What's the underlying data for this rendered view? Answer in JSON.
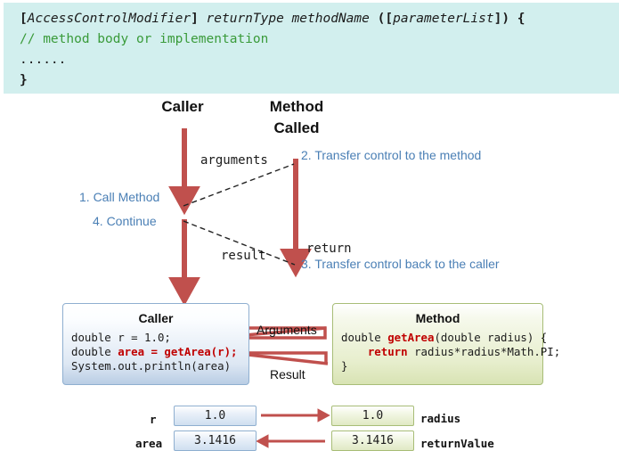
{
  "syntax_block": {
    "bg_color": "#d2efee",
    "line1": {
      "open_bracket": "[",
      "modifier": "AccessControlModifier",
      "close_bracket": "]",
      "return_type": "returnType",
      "method_name": "methodName",
      "open_paren": "(",
      "open_bracket2": "[",
      "parameter_list": "parameterList",
      "close_bracket2": "]",
      "close_paren": ")",
      "open_brace": "{",
      "full": "[AccessControlModifier] returnType methodName ([parameterList]) {"
    },
    "line2": "// method body or implementation",
    "line2_color": "#3a9b3a",
    "line3": "......",
    "line4": "}"
  },
  "diagram": {
    "lane_caller_title": "Caller",
    "lane_method_title_line1": "Method",
    "lane_method_title_line2": "Called",
    "steps": [
      {
        "id": "step1",
        "label": "1. Call Method"
      },
      {
        "id": "step4",
        "label": "4. Continue"
      },
      {
        "id": "step2",
        "label": "2. Transfer control to the method"
      },
      {
        "id": "step3",
        "label": "3. Transfer control back to the caller"
      }
    ],
    "step_color": "#4a7fb5",
    "flow_labels": {
      "arguments": "arguments",
      "result": "result",
      "return": "return"
    },
    "arrow_color": "#c0504d"
  },
  "caller_box": {
    "title": "Caller",
    "code_line1": "double r = 1.0;",
    "code_line2_prefix": "double ",
    "code_line2_highlight": "area = getArea(r);",
    "code_line3": "System.out.println(area)",
    "bg_top": "#ffffff",
    "bg_bottom": "#b9cde4",
    "border": "#8fafd0"
  },
  "method_box": {
    "title": "Method",
    "code_line1_a": "double ",
    "code_line1_b": "getArea",
    "code_line1_c": "(double radius) {",
    "code_line2_a": "    return ",
    "code_line2_b": "radius*radius*Math.PI;",
    "code_line3": "}",
    "bg_top": "#ffffff",
    "bg_bottom": "#d8e3b4",
    "border": "#a8bd77"
  },
  "transfer_labels": {
    "arguments": "Arguments",
    "result": "Result"
  },
  "variables": [
    {
      "name": "r",
      "value": "1.0",
      "side": "caller"
    },
    {
      "name": "area",
      "value": "3.1416",
      "side": "caller"
    },
    {
      "name": "radius",
      "value": "1.0",
      "side": "method"
    },
    {
      "name": "returnValue",
      "value": "3.1416",
      "side": "method"
    }
  ]
}
